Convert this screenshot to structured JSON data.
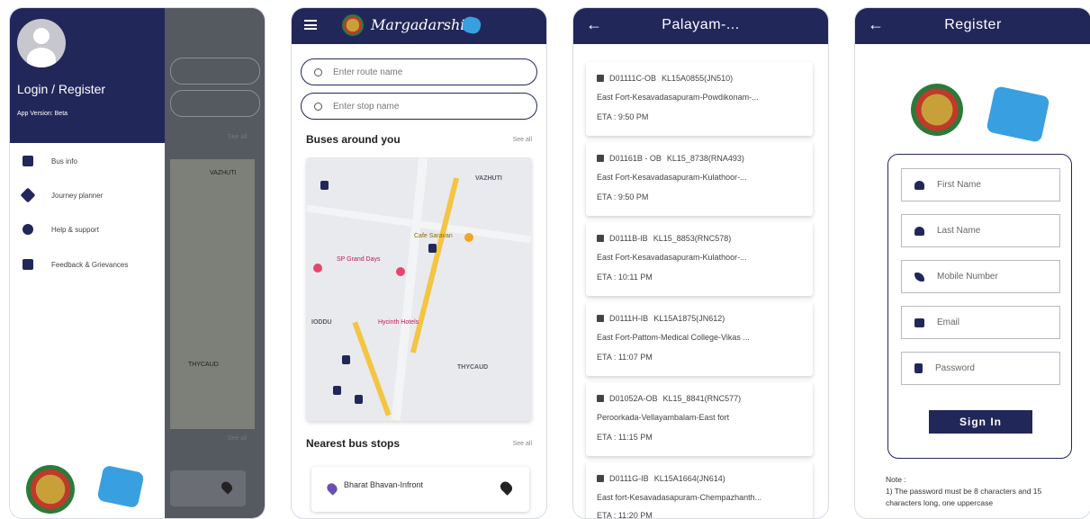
{
  "phone1": {
    "drawer": {
      "title": "Login / Register",
      "version": "App Version: Beta",
      "items": [
        {
          "label": "Bus info",
          "icon": "bus-icon"
        },
        {
          "label": "Journey planner",
          "icon": "directions-icon"
        },
        {
          "label": "Help & support",
          "icon": "help-icon"
        },
        {
          "label": "Feedback & Grievances",
          "icon": "feedback-icon"
        }
      ]
    },
    "background": {
      "see_all_1": "See all",
      "see_all_2": "See all",
      "map_label": "VAZHUTI",
      "map_label2": "THYCAUD"
    }
  },
  "phone2": {
    "brand": "Margadarshi",
    "route_placeholder": "Enter route name",
    "stop_placeholder": "Enter stop name",
    "buses_title": "Buses around you",
    "nearest_title": "Nearest bus stops",
    "see_all": "See all",
    "map_labels": {
      "vazhuthi": "VAZHUTI",
      "thycaud": "THYCAUD",
      "cafe": "Cafe Saravan",
      "hycinth": "Hycinth Hotels",
      "grand": "SP Grand Days",
      "iddu": "IODDU"
    },
    "stop": {
      "name": "Bharat Bhavan-Infront"
    }
  },
  "phone3": {
    "title": "Palayam-...",
    "trips": [
      {
        "code": "D01111C-OB",
        "reg": "KL15A0855(JN510)",
        "route": "East Fort-Kesavadasapuram-Powdikonam-...",
        "eta": "ETA : 9:50 PM"
      },
      {
        "code": "D01161B - OB",
        "reg": "KL15_8738(RNA493)",
        "route": "East Fort-Kesavadasapuram-Kulathoor-...",
        "eta": "ETA : 9:50 PM"
      },
      {
        "code": "D0111B-IB",
        "reg": "KL15_8853(RNC578)",
        "route": "East Fort-Kesavadasapuram-Kulathoor-...",
        "eta": "ETA : 10:11 PM"
      },
      {
        "code": "D0111H-IB",
        "reg": "KL15A1875(JN612)",
        "route": "East Fort-Pattom-Medical College-Vikas ...",
        "eta": "ETA : 11:07 PM"
      },
      {
        "code": "D01052A-OB",
        "reg": "KL15_8841(RNC577)",
        "route": "Peroorkada-Vellayambalam-East fort",
        "eta": "ETA : 11:15 PM"
      },
      {
        "code": "D0111G-IB",
        "reg": "KL15A1664(JN614)",
        "route": "East fort-Kesavadasapuram-Chempazhanth...",
        "eta": "ETA : 11:20 PM"
      }
    ]
  },
  "phone4": {
    "title": "Register",
    "fields": [
      {
        "placeholder": "First Name",
        "icon": "person-icon"
      },
      {
        "placeholder": "Last Name",
        "icon": "person-icon"
      },
      {
        "placeholder": "Mobile Number",
        "icon": "phone-icon"
      },
      {
        "placeholder": "Email",
        "icon": "mail-icon"
      },
      {
        "placeholder": "Password",
        "icon": "lock-icon"
      }
    ],
    "signin": "Sign In",
    "note_title": "Note :",
    "note_text": "1) The password must be 8 characters and 15 characters long, one uppercase"
  },
  "colors": {
    "primary": "#22275a",
    "accent": "#e6466d",
    "bg": "#ffffff"
  }
}
